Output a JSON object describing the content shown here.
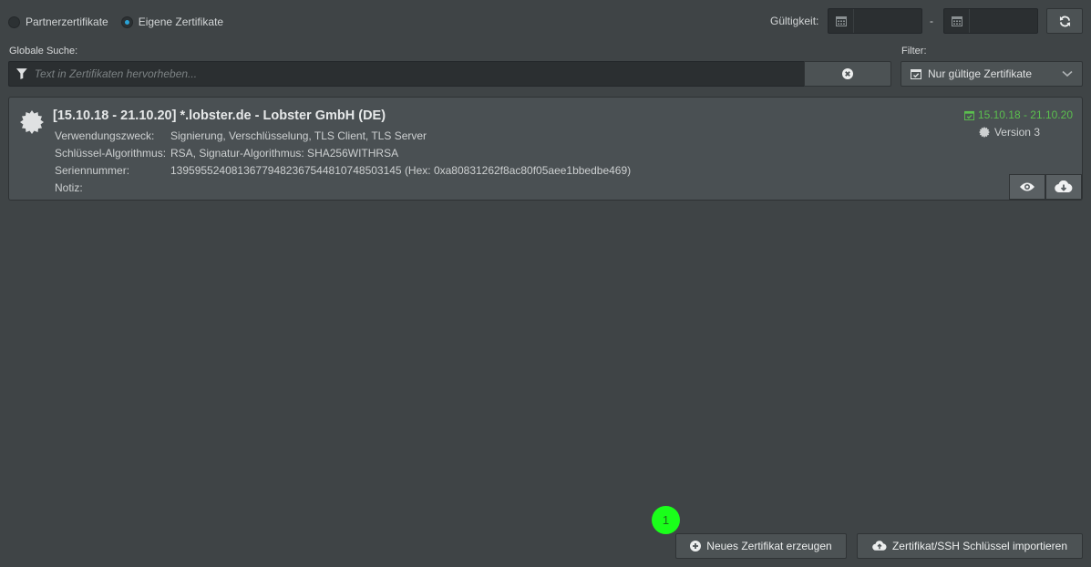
{
  "radios": {
    "partner": "Partnerzertifikate",
    "own": "Eigene Zertifikate"
  },
  "validity": {
    "label": "Gültigkeit:",
    "separator": "-"
  },
  "search": {
    "label": "Globale Suche:",
    "placeholder": "Text in Zertifikaten hervorheben..."
  },
  "filter": {
    "label": "Filter:",
    "selected": "Nur gültige Zertifikate"
  },
  "certificate": {
    "title": "[15.10.18 - 21.10.20] *.lobster.de - Lobster GmbH (DE)",
    "valid_range": "15.10.18 - 21.10.20",
    "version": "Version 3",
    "rows": [
      {
        "key": "Verwendungszweck:",
        "value": "Signierung, Verschlüsselung, TLS Client, TLS Server"
      },
      {
        "key": "Schlüssel-Algorithmus:",
        "value": "RSA, Signatur-Algorithmus: SHA256WITHRSA"
      },
      {
        "key": "Seriennummer:",
        "value": "13959552408136779482367544810748503145 (Hex: 0xa80831262f8ac80f05aee1bbedbe469)"
      },
      {
        "key": "Notiz:",
        "value": ""
      }
    ]
  },
  "actions": {
    "new_cert": "Neues Zertifikat erzeugen",
    "import": "Zertifikat/SSH Schlüssel importieren"
  },
  "marker": "1",
  "colors": {
    "background": "#3f4446",
    "accent_green": "#5bbf4e",
    "marker": "#1aff1a"
  }
}
